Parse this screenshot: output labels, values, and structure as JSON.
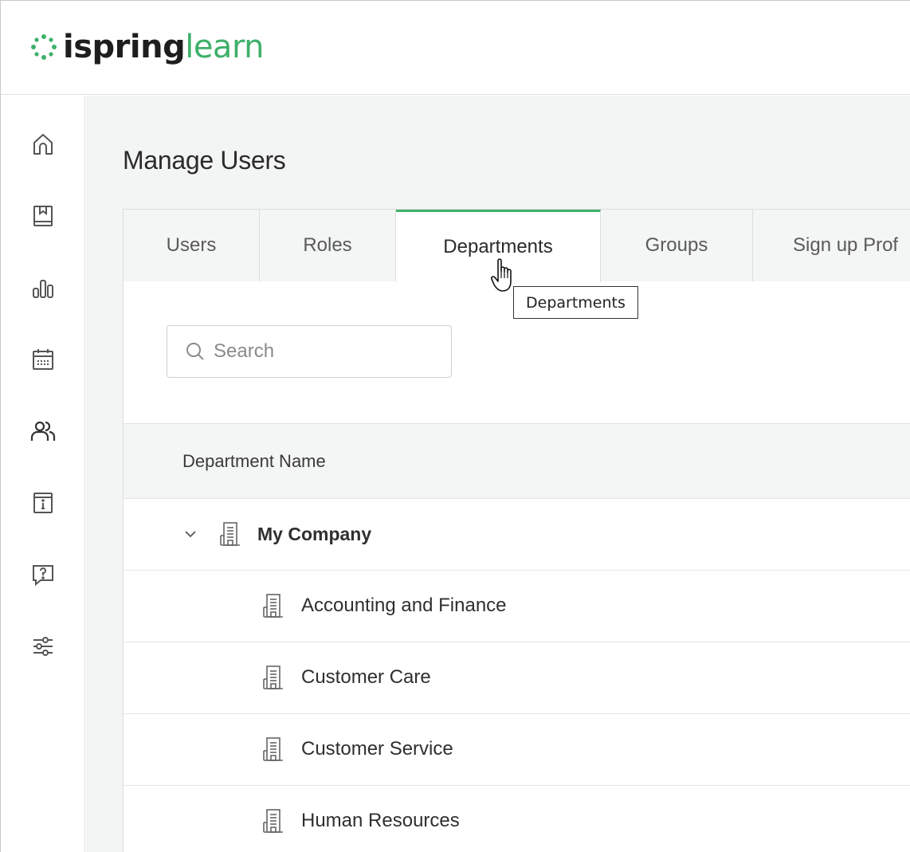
{
  "app": {
    "logo_part1": "ispring",
    "logo_part2": "learn",
    "brand_color": "#3fb06a"
  },
  "sidebar": {
    "items": [
      {
        "icon": "home-icon"
      },
      {
        "icon": "book-icon"
      },
      {
        "icon": "reports-icon"
      },
      {
        "icon": "calendar-icon"
      },
      {
        "icon": "users-icon"
      },
      {
        "icon": "info-icon"
      },
      {
        "icon": "help-icon"
      },
      {
        "icon": "settings-sliders-icon"
      }
    ]
  },
  "page": {
    "title": "Manage Users"
  },
  "tabs": [
    {
      "label": "Users",
      "active": false
    },
    {
      "label": "Roles",
      "active": false
    },
    {
      "label": "Departments",
      "active": true
    },
    {
      "label": "Groups",
      "active": false
    },
    {
      "label": "Sign up Prof",
      "active": false
    }
  ],
  "tooltip": {
    "text": "Departments"
  },
  "search": {
    "placeholder": "Search",
    "value": ""
  },
  "table": {
    "header": "Department Name",
    "root": {
      "label": "My Company",
      "expanded": true
    },
    "rows": [
      {
        "label": "Accounting and Finance"
      },
      {
        "label": "Customer Care"
      },
      {
        "label": "Customer Service"
      },
      {
        "label": "Human Resources"
      }
    ]
  }
}
